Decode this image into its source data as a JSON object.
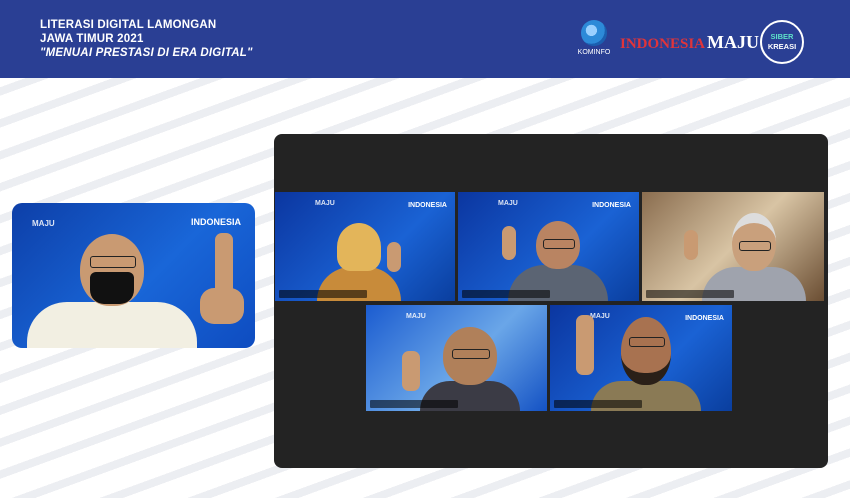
{
  "banner": {
    "line1": "LITERASI DIGITAL LAMONGAN",
    "line2": "JAWA TIMUR 2021",
    "tagline": "\"MENUAI PRESTASI DI ERA DIGITAL\"",
    "kominfo_label": "KOMINFO",
    "indonesia_label": "INDONESIA",
    "maju_label": "MAJU",
    "siber_label": "SIBER",
    "kreasi_label": "KREASI",
    "bg_color": "#2a3f94"
  },
  "host": {
    "tile_logo": "MAJU",
    "tile_tag": "INDONESIA"
  },
  "call": {
    "tile_tag": "INDONESIA",
    "tile_logo": "MAJU",
    "participants": [
      {
        "id": "speaker-1"
      },
      {
        "id": "speaker-2"
      },
      {
        "id": "speaker-3"
      },
      {
        "id": "speaker-4"
      },
      {
        "id": "speaker-5"
      }
    ]
  }
}
